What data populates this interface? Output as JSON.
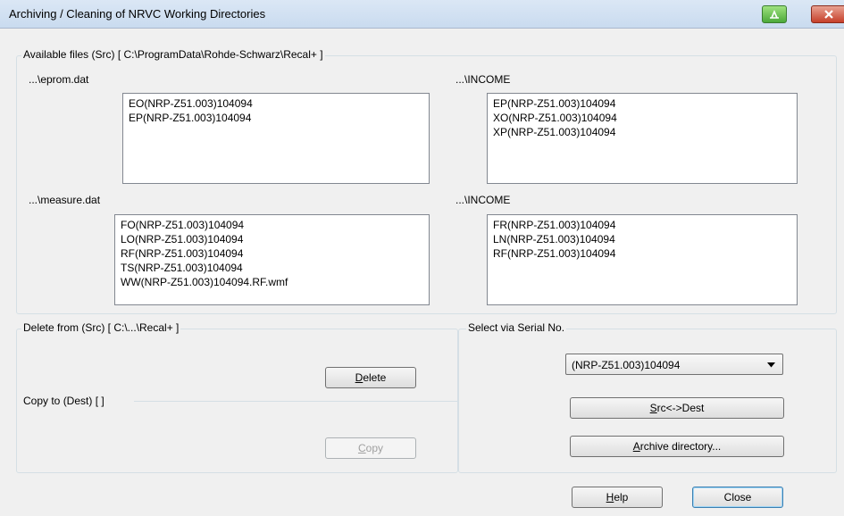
{
  "window": {
    "title": "Archiving / Cleaning of NRVC Working Directories"
  },
  "available": {
    "group_label": "Available files (Src) [ C:\\ProgramData\\Rohde-Schwarz\\Recal+ ]",
    "eprom_label": "...\\eprom.dat",
    "eprom_items": [
      "EO(NRP-Z51.003)104094",
      "EP(NRP-Z51.003)104094"
    ],
    "income1_label": "...\\INCOME",
    "income1_items": [
      "EP(NRP-Z51.003)104094",
      "XO(NRP-Z51.003)104094",
      "XP(NRP-Z51.003)104094"
    ],
    "measure_label": "...\\measure.dat",
    "measure_items": [
      "FO(NRP-Z51.003)104094",
      "LO(NRP-Z51.003)104094",
      "RF(NRP-Z51.003)104094",
      "TS(NRP-Z51.003)104094",
      "WW(NRP-Z51.003)104094.RF.wmf"
    ],
    "income2_label": "...\\INCOME",
    "income2_items": [
      "FR(NRP-Z51.003)104094",
      "LN(NRP-Z51.003)104094",
      "RF(NRP-Z51.003)104094"
    ]
  },
  "delete_group": {
    "label": "Delete from (Src) [ C:\\...\\Recal+ ]",
    "button_rest": "elete",
    "button_ul": "D"
  },
  "copy_group": {
    "label": "Copy to (Dest) [  ]",
    "button_ul": "C",
    "button_rest": "opy"
  },
  "select_group": {
    "label": "Select via Serial No.",
    "combo_value": "(NRP-Z51.003)104094",
    "swap_ul": "S",
    "swap_rest": "rc<->Dest",
    "archive_ul": "A",
    "archive_rest": "rchive directory..."
  },
  "footer": {
    "help_ul": "H",
    "help_rest": "elp",
    "close_label": "Close"
  },
  "colors": {
    "title_bar": "#c9dbef",
    "dialog_bg": "#f0f0f0",
    "close_button": "#c6402a",
    "restore_button": "#4ca93a"
  }
}
